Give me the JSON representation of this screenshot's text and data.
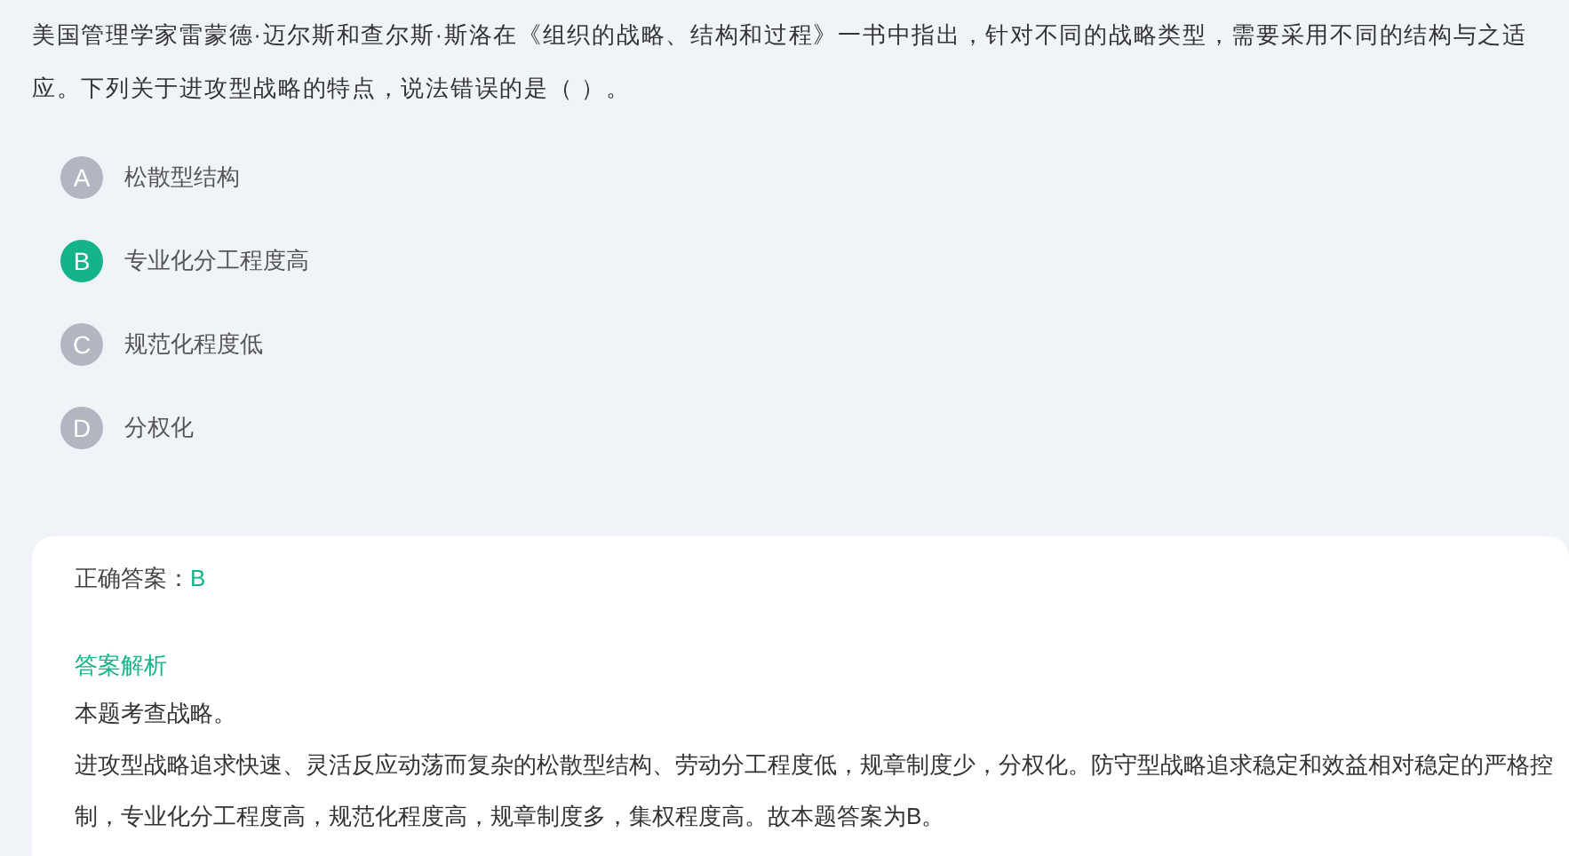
{
  "question": "美国管理学家雷蒙德·迈尔斯和查尔斯·斯洛在《组织的战略、结构和过程》一书中指出，针对不同的战略类型，需要采用不同的结构与之适应。下列关于进攻型战略的特点，说法错误的是（ ）。",
  "options": [
    {
      "letter": "A",
      "text": "松散型结构",
      "selected": false
    },
    {
      "letter": "B",
      "text": "专业化分工程度高",
      "selected": true
    },
    {
      "letter": "C",
      "text": "规范化程度低",
      "selected": false
    },
    {
      "letter": "D",
      "text": "分权化",
      "selected": false
    }
  ],
  "answer_card": {
    "correct_label": "正确答案：",
    "correct_value": "B",
    "analysis_title": "答案解析",
    "paragraphs": [
      "本题考查战略。",
      "进攻型战略追求快速、灵活反应动荡而复杂的松散型结构、劳动分工程度低，规章制度少，分权化。防守型战略追求稳定和效益相对稳定的严格控制，专业化分工程度高，规范化程度高，规章制度多，集权程度高。故本题答案为B。"
    ]
  }
}
